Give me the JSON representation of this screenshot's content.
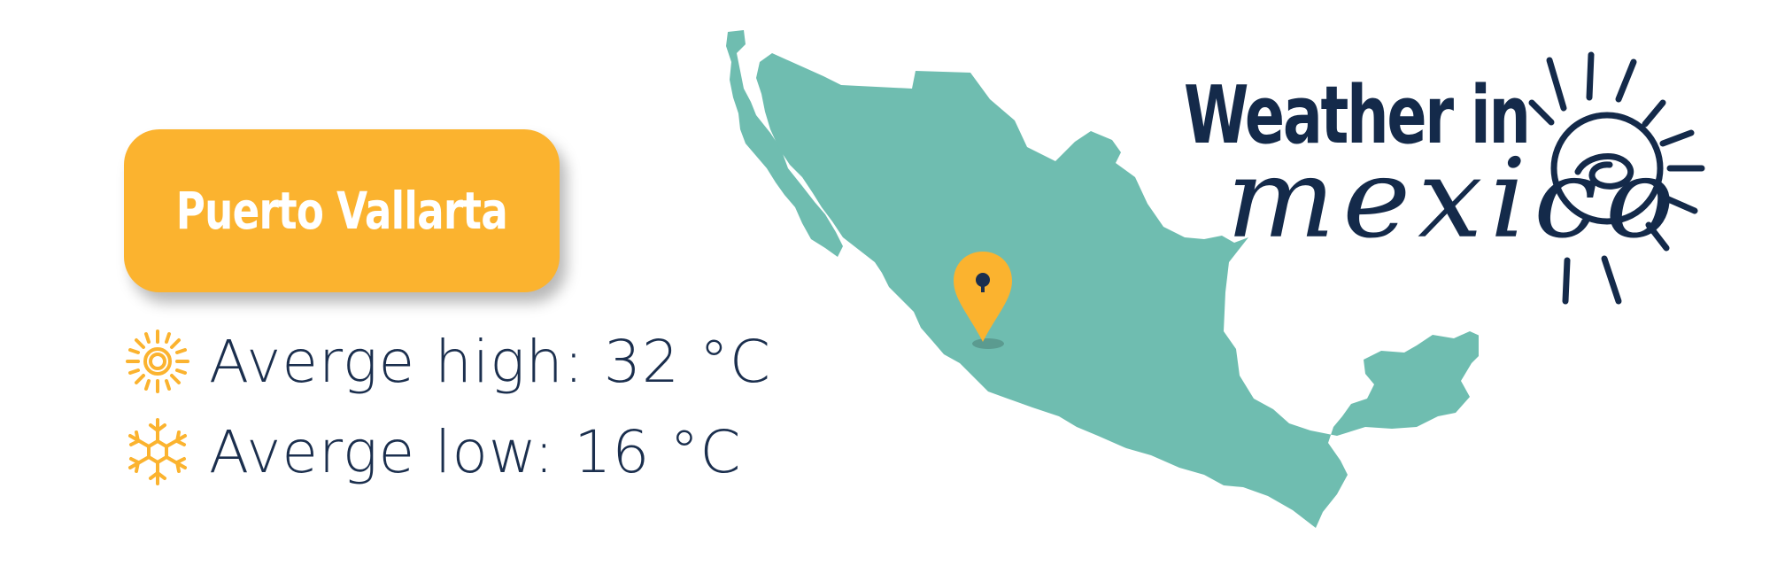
{
  "city": {
    "name": "Puerto Vallarta"
  },
  "temperatures": {
    "high": {
      "label": "Averge high: 32 °C",
      "icon": "sun-icon"
    },
    "low": {
      "label": "Averge low: 16 °C",
      "icon": "snowflake-icon"
    }
  },
  "title": {
    "line1": "Weather in",
    "line2": "mexico"
  },
  "map": {
    "icon": "location-pin-icon",
    "region_icon": "mexico-map"
  },
  "colors": {
    "accent": "#fbb32f",
    "map_fill": "#6fbdb0",
    "text": "#1b2f4e",
    "title": "#142a4a"
  }
}
